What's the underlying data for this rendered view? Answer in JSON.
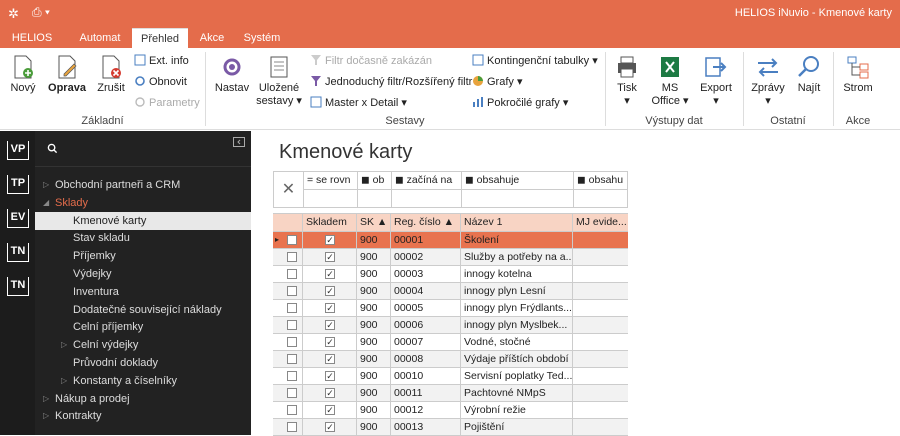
{
  "titlebar": {
    "title": "HELIOS iNuvio - Kmenové karty"
  },
  "tabs": [
    "HELIOS",
    "Automat",
    "Přehled",
    "Akce",
    "Systém"
  ],
  "ribbon": {
    "zakladni": {
      "new": "Nový",
      "edit": "Oprava",
      "delete": "Zrušit",
      "ext_info": "Ext. info",
      "refresh": "Obnovit",
      "params": "Parametry",
      "group": "Základní"
    },
    "sestavy": {
      "nastav": "Nastav",
      "ulozene": "Uložené",
      "sestavy_btn": "sestavy",
      "filtr_zakazan": "Filtr dočasně zakázán",
      "jednoduchy": "Jednoduchý filtr/Rozšířený filtr",
      "master": "Master x Detail",
      "kontingencni": "Kontingenční tabulky",
      "grafy": "Grafy",
      "pokrocile": "Pokročilé grafy",
      "group": "Sestavy"
    },
    "vystupy": {
      "tisk": "Tisk",
      "ms": "MS",
      "office": "Office",
      "export": "Export",
      "group": "Výstupy dat"
    },
    "ostatni": {
      "zpravy": "Zprávy",
      "najit": "Najít",
      "group": "Ostatní"
    },
    "akce": {
      "strom": "Strom",
      "group": "Akce"
    }
  },
  "leftbar": [
    "VP",
    "TP",
    "EV",
    "TN",
    "TN"
  ],
  "nav": {
    "items": [
      {
        "label": "Obchodní partneři a CRM",
        "level": 0,
        "expandable": true
      },
      {
        "label": "Sklady",
        "level": 0,
        "expanded": true
      },
      {
        "label": "Kmenové karty",
        "level": 1,
        "selected": true
      },
      {
        "label": "Stav skladu",
        "level": 1
      },
      {
        "label": "Příjemky",
        "level": 1
      },
      {
        "label": "Výdejky",
        "level": 1
      },
      {
        "label": "Inventura",
        "level": 1
      },
      {
        "label": "Dodatečné související náklady",
        "level": 1
      },
      {
        "label": "Celní příjemky",
        "level": 1
      },
      {
        "label": "Celní výdejky",
        "level": 1,
        "expandable": true
      },
      {
        "label": "Průvodní doklady",
        "level": 1
      },
      {
        "label": "Konstanty a číselníky",
        "level": 1,
        "expandable": true
      },
      {
        "label": "Nákup a prodej",
        "level": 0,
        "expandable": true
      },
      {
        "label": "Kontrakty",
        "level": 0,
        "expandable": true
      }
    ]
  },
  "content": {
    "title": "Kmenové karty",
    "filter": [
      "= se rovn",
      "ob",
      "začíná na",
      "obsahuje",
      "obsahu"
    ],
    "columns": [
      "Skladem",
      "SK",
      "Reg. číslo",
      "Název 1",
      "MJ evide..."
    ],
    "rows": [
      {
        "sk": "900",
        "reg": "00001",
        "name": "Školení"
      },
      {
        "sk": "900",
        "reg": "00002",
        "name": "Služby a potřeby na a..."
      },
      {
        "sk": "900",
        "reg": "00003",
        "name": "innogy kotelna"
      },
      {
        "sk": "900",
        "reg": "00004",
        "name": "innogy plyn Lesní"
      },
      {
        "sk": "900",
        "reg": "00005",
        "name": "innogy plyn Frýdlants..."
      },
      {
        "sk": "900",
        "reg": "00006",
        "name": "innogy plyn Myslbek..."
      },
      {
        "sk": "900",
        "reg": "00007",
        "name": "Vodné, stočné"
      },
      {
        "sk": "900",
        "reg": "00008",
        "name": "Výdaje příštích období"
      },
      {
        "sk": "900",
        "reg": "00010",
        "name": "Servisní poplatky Ted..."
      },
      {
        "sk": "900",
        "reg": "00011",
        "name": "Pachtovné NMpS"
      },
      {
        "sk": "900",
        "reg": "00012",
        "name": "Výrobní režie"
      },
      {
        "sk": "900",
        "reg": "00013",
        "name": "Pojištění"
      }
    ]
  },
  "colors": {
    "accent": "#e46c4b",
    "selected_row": "#e8734f",
    "header": "#f8d4c4"
  }
}
